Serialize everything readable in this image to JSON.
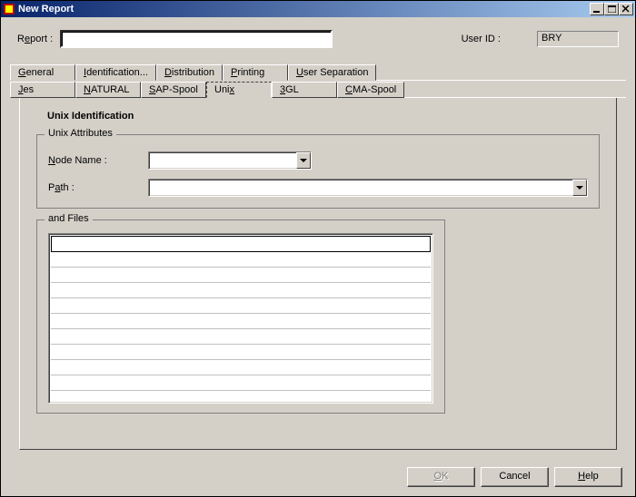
{
  "window": {
    "title": "New Report"
  },
  "header": {
    "report_label_pre": "R",
    "report_label_u": "e",
    "report_label_post": "port :",
    "report_value": "",
    "userid_label": "User ID :",
    "userid_value": "BRY"
  },
  "tabs": {
    "row1": [
      {
        "pre": "",
        "u": "G",
        "post": "eneral"
      },
      {
        "pre": "",
        "u": "I",
        "post": "dentification..."
      },
      {
        "pre": "",
        "u": "D",
        "post": "istribution"
      },
      {
        "pre": "",
        "u": "P",
        "post": "rinting"
      },
      {
        "pre": "",
        "u": "U",
        "post": "ser Separation"
      }
    ],
    "row2": [
      {
        "pre": "",
        "u": "J",
        "post": "es"
      },
      {
        "pre": "",
        "u": "N",
        "post": "ATURAL"
      },
      {
        "pre": "",
        "u": "S",
        "post": "AP-Spool"
      },
      {
        "pre": "Uni",
        "u": "x",
        "post": ""
      },
      {
        "pre": "",
        "u": "3",
        "post": "GL"
      },
      {
        "pre": "",
        "u": "C",
        "post": "MA-Spool"
      }
    ]
  },
  "section": {
    "title": "Unix Identification",
    "group1_title": "Unix Attributes",
    "node_label_pre": "",
    "node_label_u": "N",
    "node_label_post": "ode Name :",
    "node_value": "",
    "path_label_pre": "P",
    "path_label_u": "a",
    "path_label_post": "th :",
    "path_value": "",
    "files_title_pre": "and  ",
    "files_title_u": "F",
    "files_title_post": "iles",
    "file_rows": [
      "",
      "",
      "",
      "",
      "",
      "",
      "",
      "",
      ""
    ]
  },
  "buttons": {
    "ok_pre": "",
    "ok_u": "O",
    "ok_post": "K",
    "cancel": "Cancel",
    "help_pre": "",
    "help_u": "H",
    "help_post": "elp"
  }
}
